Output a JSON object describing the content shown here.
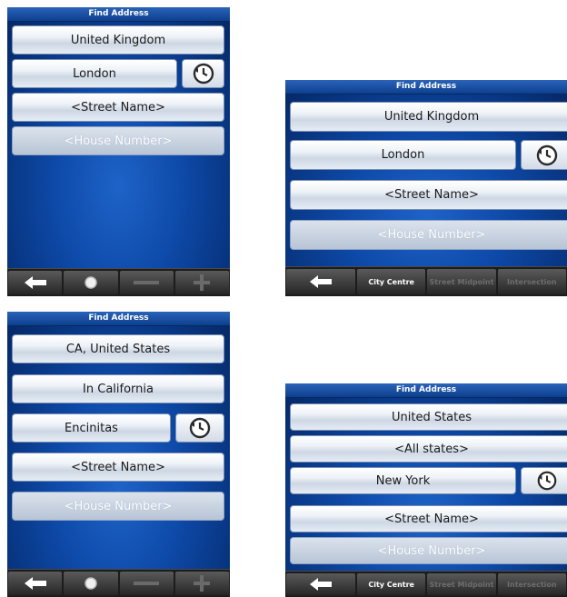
{
  "screens": [
    {
      "title": "Find Address",
      "country": "United Kingdom",
      "city": "London",
      "street": "<Street Name>",
      "house": "<House Number>",
      "toolbar": [
        "back-arrow-icon",
        "circle-icon",
        "minus-icon",
        "plus-icon"
      ]
    },
    {
      "title": "Find Address",
      "country": "United Kingdom",
      "city": "London",
      "street": "<Street Name>",
      "house": "<House Number>",
      "toolbar": [
        "City Centre",
        "Street Midpoint",
        "Intersection"
      ]
    },
    {
      "title": "Find Address",
      "state": "CA, United States",
      "city_area": "In California",
      "city": "Encinitas",
      "street": "<Street Name>",
      "house": "<House Number>",
      "toolbar": [
        "back-arrow-icon",
        "circle-icon",
        "minus-icon",
        "plus-icon"
      ]
    },
    {
      "title": "Find Address",
      "country": "United States",
      "state": "<All states>",
      "city": "New York",
      "street": "<Street Name>",
      "house": "<House Number>",
      "toolbar": [
        "City Centre",
        "Street Midpoint",
        "Intersection"
      ]
    }
  ]
}
